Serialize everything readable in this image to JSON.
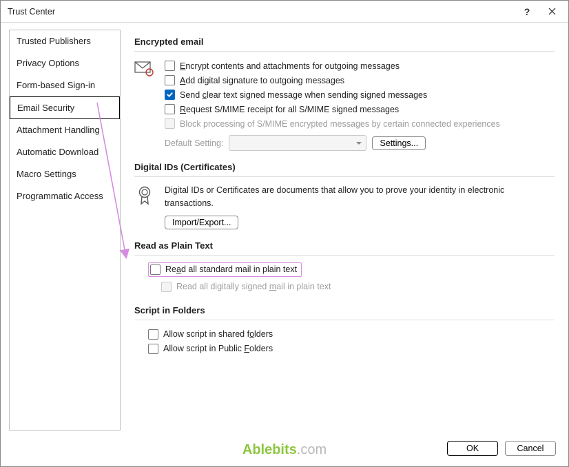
{
  "title": "Trust Center",
  "sidebar": {
    "items": [
      {
        "label": "Trusted Publishers"
      },
      {
        "label": "Privacy Options"
      },
      {
        "label": "Form-based Sign-in"
      },
      {
        "label": "Email Security"
      },
      {
        "label": "Attachment Handling"
      },
      {
        "label": "Automatic Download"
      },
      {
        "label": "Macro Settings"
      },
      {
        "label": "Programmatic Access"
      }
    ],
    "selected": "Email Security"
  },
  "sections": {
    "encrypted": {
      "title": "Encrypted email",
      "opts": {
        "encrypt": "Encrypt contents and attachments for outgoing messages",
        "sign": "Add digital signature to outgoing messages",
        "cleartext": "Send clear text signed message when sending signed messages",
        "receipt": "Request S/MIME receipt for all S/MIME signed messages",
        "block": "Block processing of S/MIME encrypted messages by certain connected experiences"
      },
      "default_label": "Default Setting:",
      "settings_btn": "Settings..."
    },
    "digital": {
      "title": "Digital IDs (Certificates)",
      "desc": "Digital IDs or Certificates are documents that allow you to prove your identity in electronic transactions.",
      "import_btn": "Import/Export..."
    },
    "plain": {
      "title": "Read as Plain Text",
      "opt1": "Read all standard mail in plain text",
      "opt2": "Read all digitally signed mail in plain text"
    },
    "script": {
      "title": "Script in Folders",
      "opt1": "Allow script in shared folders",
      "opt2": "Allow script in Public Folders"
    }
  },
  "footer": {
    "ok": "OK",
    "cancel": "Cancel"
  },
  "watermark": {
    "a": "Ablebits",
    "b": ".com"
  }
}
